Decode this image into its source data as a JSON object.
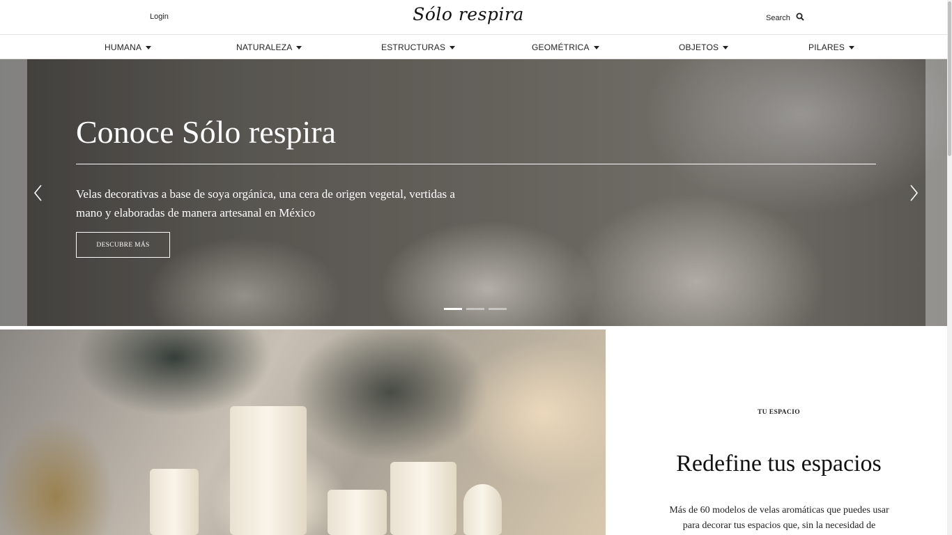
{
  "header": {
    "login_label": "Login",
    "logo_text": "Sólo respira",
    "search_label": "Search"
  },
  "nav": {
    "items": [
      {
        "label": "HUMANA"
      },
      {
        "label": "NATURALEZA"
      },
      {
        "label": "ESTRUCTURAS"
      },
      {
        "label": "GEOMÉTRICA"
      },
      {
        "label": "OBJETOS"
      },
      {
        "label": "PILARES"
      }
    ]
  },
  "hero": {
    "title": "Conoce Sólo respira",
    "subtitle": "Velas decorativas a base de soya orgánica, una cera de origen vegetal, vertidas a mano y elaboradas de manera artesanal en México",
    "button_label": "DESCUBRE MÁS",
    "slide_count": 3,
    "active_slide": 1
  },
  "section": {
    "eyebrow": "TU ESPACIO",
    "title": "Redefine tus espacios",
    "body": "Más de 60 modelos de velas aromáticas que puedes usar para decorar tus espacios que, sin la necesidad de"
  },
  "colors": {
    "text": "#111111",
    "border": "#e6e6e6",
    "hero_text": "#ffffff"
  },
  "icons": [
    "search-icon",
    "caret-down-icon",
    "chevron-left-icon",
    "chevron-right-icon"
  ]
}
